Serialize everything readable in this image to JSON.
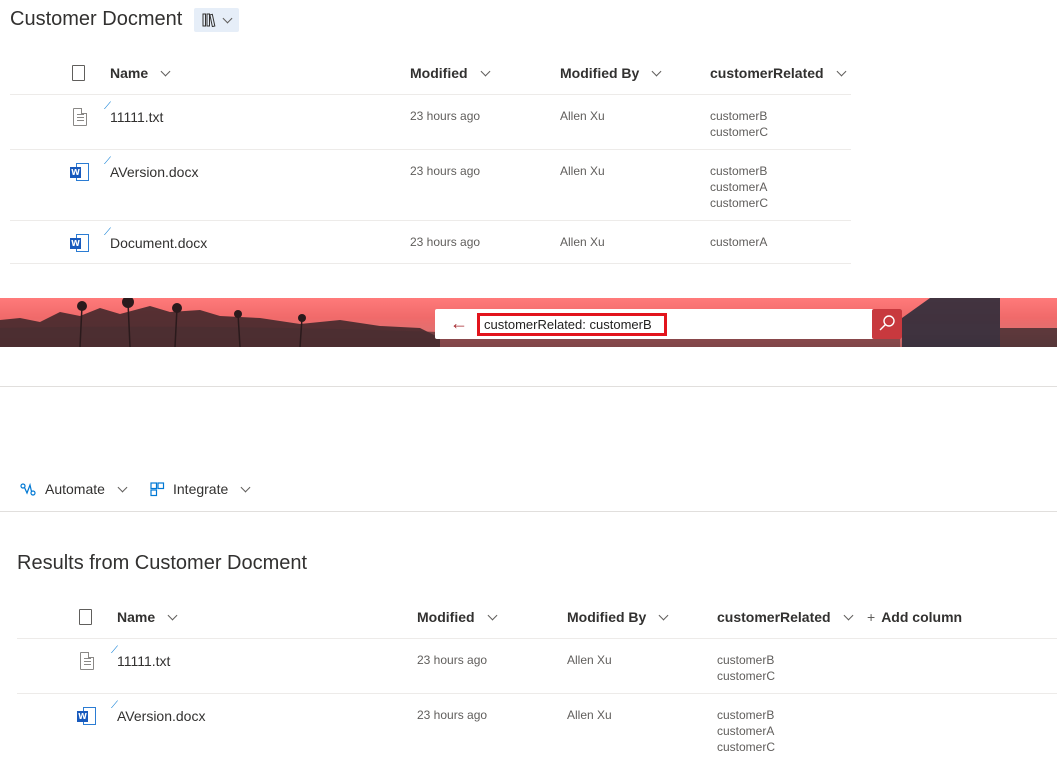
{
  "library": {
    "title": "Customer Docment",
    "columns": {
      "name": "Name",
      "modified": "Modified",
      "modified_by": "Modified By",
      "custom": "customerRelated"
    },
    "rows": [
      {
        "icon": "text-file-icon",
        "name": "11111.txt",
        "modified": "23 hours ago",
        "modified_by": "Allen Xu",
        "tags": [
          "customerB",
          "customerC"
        ]
      },
      {
        "icon": "word-file-icon",
        "name": "AVersion.docx",
        "modified": "23 hours ago",
        "modified_by": "Allen Xu",
        "tags": [
          "customerB",
          "customerA",
          "customerC"
        ]
      },
      {
        "icon": "word-file-icon",
        "name": "Document.docx",
        "modified": "23 hours ago",
        "modified_by": "Allen Xu",
        "tags": [
          "customerA"
        ]
      }
    ]
  },
  "search": {
    "query": "customerRelated: customerB",
    "highlight_color": "#e2141c",
    "button_color": "#c8393e"
  },
  "commands": {
    "automate": "Automate",
    "integrate": "Integrate"
  },
  "results": {
    "title": "Results from Customer Docment",
    "columns": {
      "name": "Name",
      "modified": "Modified",
      "modified_by": "Modified By",
      "custom": "customerRelated",
      "add_column": "Add column"
    },
    "rows": [
      {
        "icon": "text-file-icon",
        "name": "11111.txt",
        "modified": "23 hours ago",
        "modified_by": "Allen Xu",
        "tags": [
          "customerB",
          "customerC"
        ]
      },
      {
        "icon": "word-file-icon",
        "name": "AVersion.docx",
        "modified": "23 hours ago",
        "modified_by": "Allen Xu",
        "tags": [
          "customerB",
          "customerA",
          "customerC"
        ]
      }
    ]
  },
  "colors": {
    "accent": "#0078d4",
    "word_blue": "#185abd",
    "text": "#323130",
    "secondary_text": "#605e5c"
  }
}
